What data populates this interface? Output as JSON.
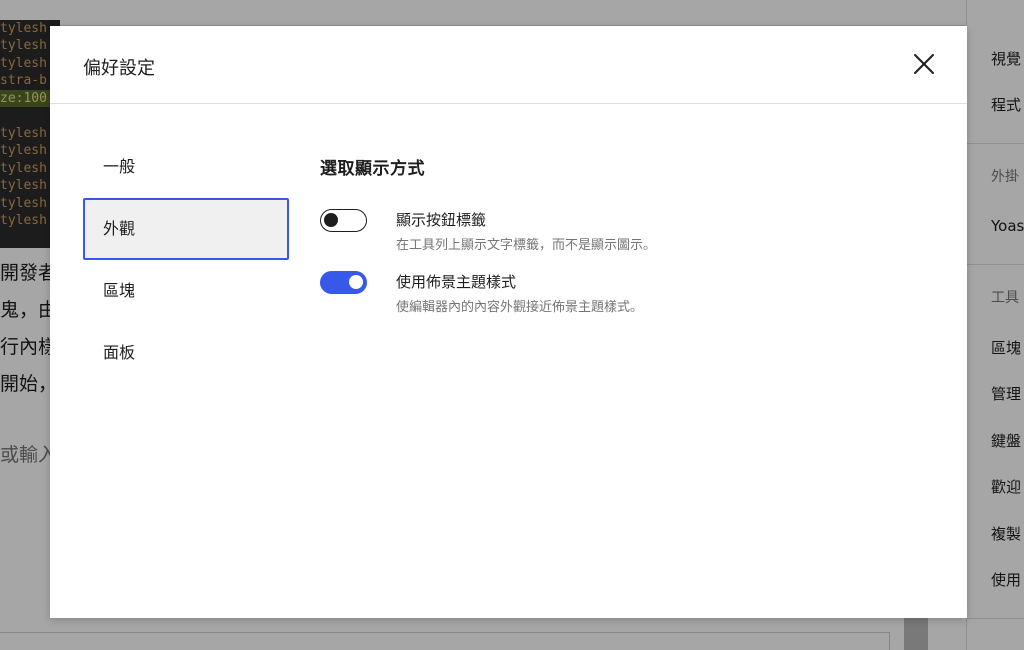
{
  "background": {
    "code_lines": [
      "tylesh",
      "tylesh",
      "tylesh",
      "stra-b",
      "ze:100",
      "tylesh",
      "tylesh",
      "tylesh",
      "tylesh",
      "tylesh",
      "tylesh"
    ],
    "text_lines": [
      "開發者",
      "鬼，由",
      "行內樣",
      "開始，"
    ],
    "placeholder": "或輸入",
    "sidebar": {
      "items": [
        "視覺",
        "程式",
        "外掛",
        "Yoas",
        "工具",
        "區塊",
        "管理",
        "鍵盤",
        "歡迎",
        "複製",
        "使用"
      ]
    }
  },
  "modal": {
    "title": "偏好設定",
    "close_icon": "close-icon",
    "nav": {
      "items": [
        "一般",
        "外觀",
        "區塊",
        "面板"
      ],
      "active_index": 1
    },
    "section": {
      "title": "選取顯示方式",
      "options": [
        {
          "label": "顯示按鈕標籤",
          "help": "在工具列上顯示文字標籤，而不是顯示圖示。",
          "enabled": false
        },
        {
          "label": "使用佈景主題樣式",
          "help": "使編輯器內的內容外觀接近佈景主題樣式。",
          "enabled": true
        }
      ]
    }
  },
  "colors": {
    "accent": "#3858e9",
    "text": "#1e1e1e",
    "muted": "#757575"
  }
}
